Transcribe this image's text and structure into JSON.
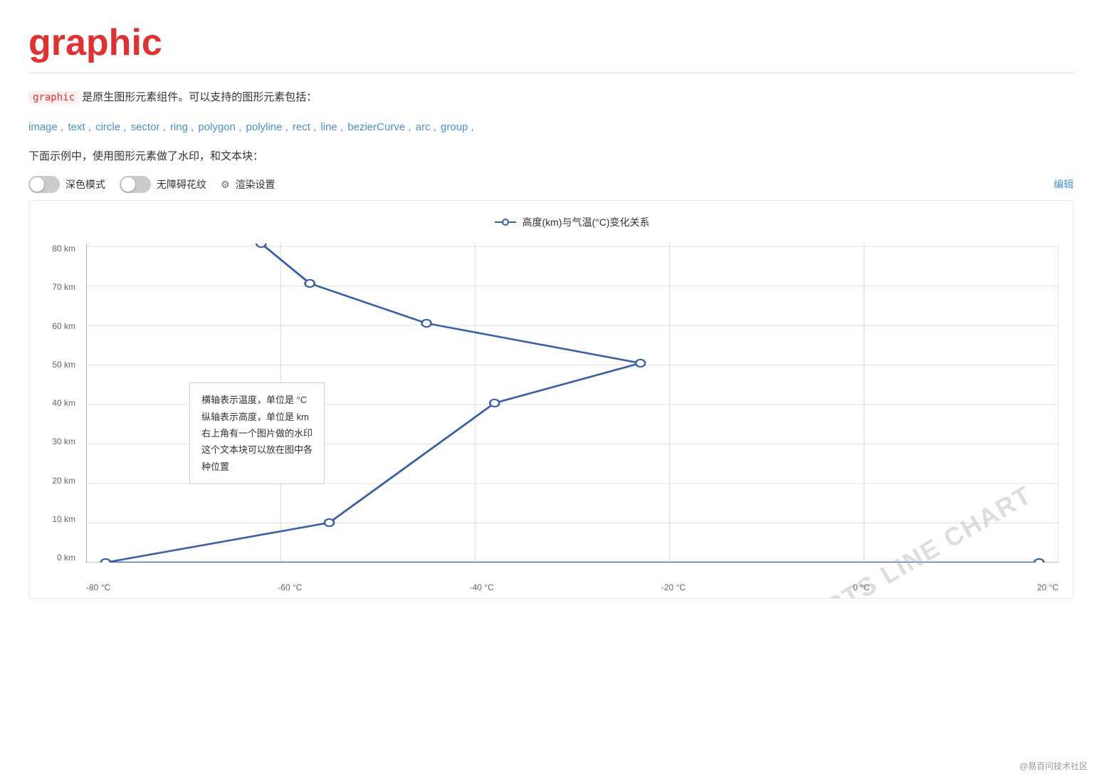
{
  "page": {
    "title": "graphic",
    "description_prefix": "graphic",
    "description_text": " 是原生图形元素组件。可以支持的图形元素包括：",
    "type_list": [
      "image",
      "text",
      "circle",
      "sector",
      "ring",
      "polygon",
      "polyline",
      "rect",
      "line",
      "bezierCurve",
      "arc",
      "group"
    ],
    "subtitle": "下面示例中，使用图形元素做了水印，和文本块："
  },
  "toolbar": {
    "dark_mode_label": "深色模式",
    "accessibility_label": "无障碍花纹",
    "render_label": "渲染设置",
    "edit_label": "编辑"
  },
  "chart": {
    "title": "高度(km)与气温(°C)变化关系",
    "y_labels": [
      "0 km",
      "10 km",
      "20 km",
      "30 km",
      "40 km",
      "50 km",
      "60 km",
      "70 km",
      "80 km"
    ],
    "x_labels": [
      "-80 °C",
      "-60 °C",
      "-40 °C",
      "-20 °C",
      "0 °C",
      "20 °C"
    ],
    "watermark": "ECHARTS LINE CHART",
    "text_block": {
      "line1": "横轴表示温度，单位是 °C",
      "line2": "纵轴表示高度，单位是 km",
      "line3": "右上角有一个图片做的水印",
      "line4": "这个文本块可以放在图中各",
      "line5": "种位置"
    }
  },
  "footer": {
    "brand": "@易百问技术社区"
  }
}
